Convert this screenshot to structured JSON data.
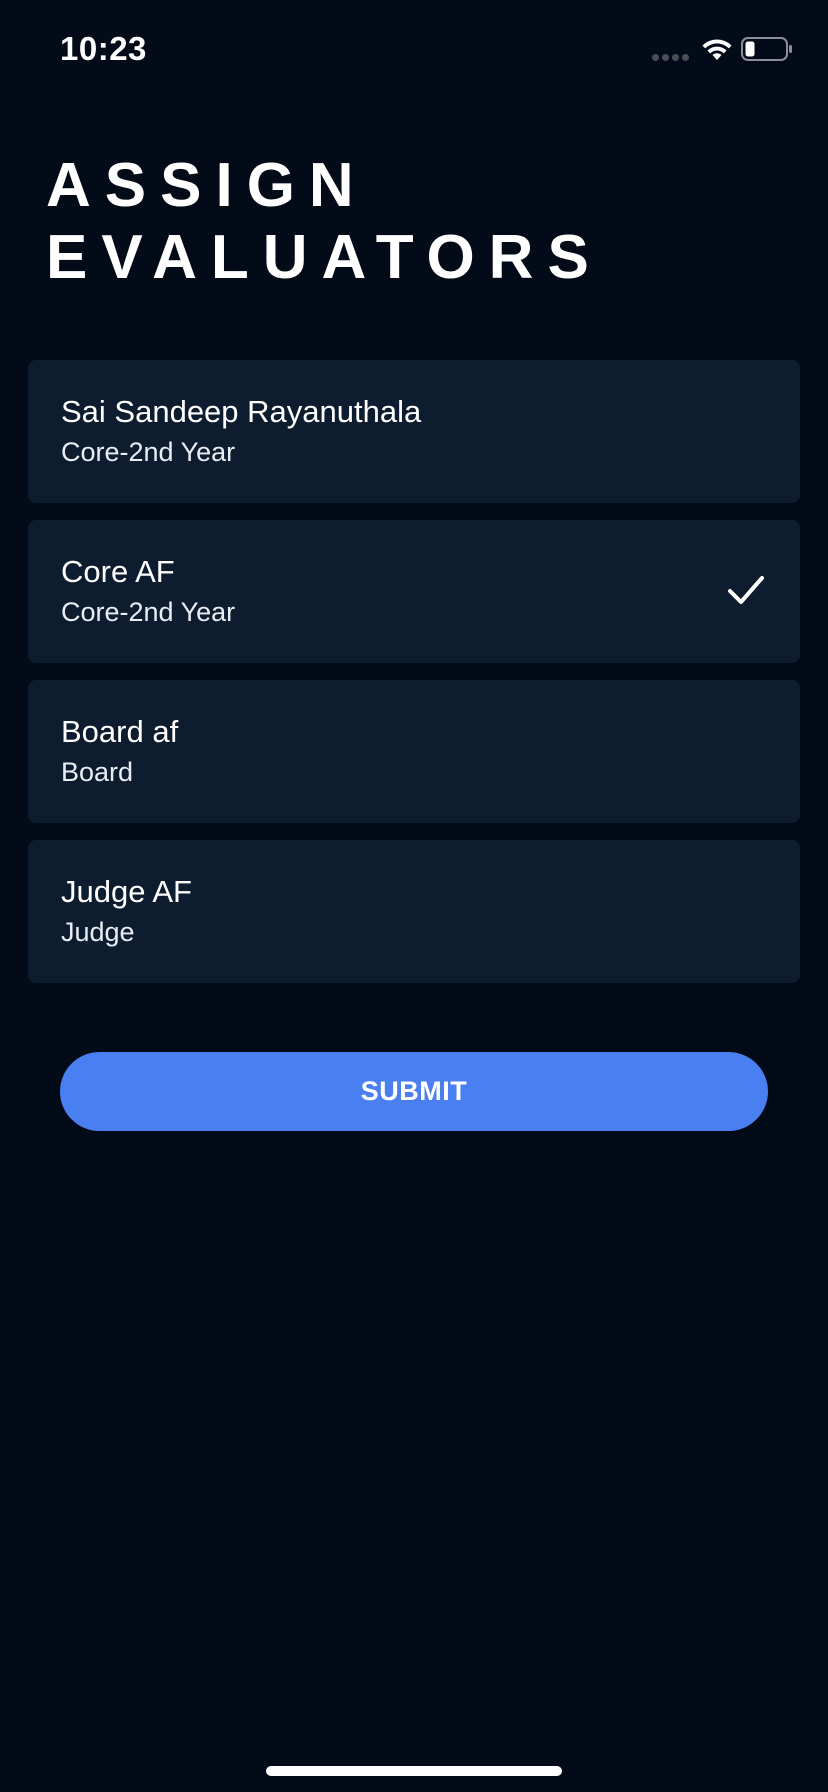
{
  "status_bar": {
    "time": "10:23",
    "icons": [
      "signal-dots-icon",
      "wifi-icon",
      "battery-icon"
    ]
  },
  "header": {
    "title_line1": "ASSIGN",
    "title_line2": "EVALUATORS"
  },
  "evaluators": [
    {
      "name": "Sai Sandeep Rayanuthala",
      "role": "Core-2nd Year",
      "selected": false
    },
    {
      "name": "Core AF",
      "role": "Core-2nd Year",
      "selected": true
    },
    {
      "name": "Board af",
      "role": "Board",
      "selected": false
    },
    {
      "name": "Judge AF",
      "role": "Judge",
      "selected": false
    }
  ],
  "actions": {
    "submit_label": "SUBMIT"
  },
  "colors": {
    "background": "#040b18",
    "card": "#0d1c2e",
    "accent": "#4a7ff2",
    "text": "#ffffff"
  }
}
